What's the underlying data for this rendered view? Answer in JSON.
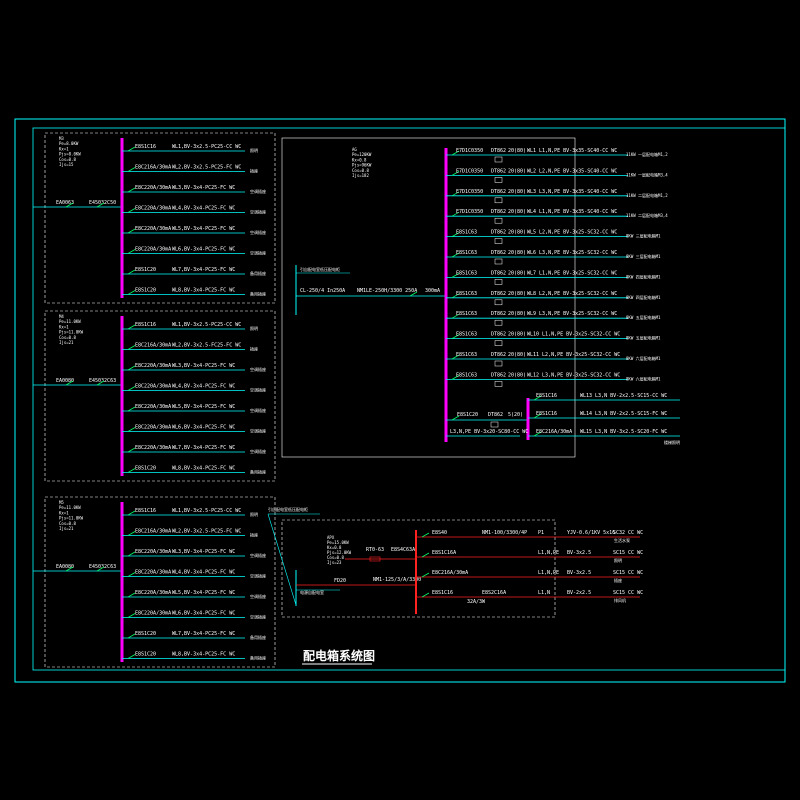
{
  "title": "配电箱系统图",
  "colors": {
    "border": "#00ffff",
    "panel_frame": "#ffffff",
    "busbar": "#ff00ff",
    "feeder": "#00ffff",
    "switch": "#00ff66",
    "red_bus": "#ff2020",
    "text": "#ffffff"
  },
  "panels": [
    {
      "id": "panel-1",
      "header": [
        "M3",
        "Pe=8.0KW",
        "Kx=1",
        "Pjs=8.0KW",
        "Cos=0.8",
        "Ijs=15"
      ],
      "incoming": [
        "EA0063",
        "E45032C50"
      ],
      "branches": [
        {
          "breaker": "E8S1C16",
          "cable": "WL1,BV-3x2.5-PC25-CC WC",
          "load": "照明"
        },
        {
          "breaker": "E8C216A/30mA",
          "cable": "WL2,BV-3x2.5-PC25-FC WC",
          "load": "插座"
        },
        {
          "breaker": "E8C220A/30mA",
          "cable": "WL3,BV-3x4-PC25-FC WC",
          "load": "空调插座"
        },
        {
          "breaker": "E8C220A/30mA",
          "cable": "WL4,BV-3x4-PC25-FC WC",
          "load": "空调插座"
        },
        {
          "breaker": "E8C220A/30mA",
          "cable": "WL5,BV-3x4-PC25-FC WC",
          "load": "空调插座"
        },
        {
          "breaker": "E8C220A/30mA",
          "cable": "WL6,BV-3x4-PC25-FC WC",
          "load": "空调插座"
        },
        {
          "breaker": "E8S1C20",
          "cable": "WL7,BV-3x4-PC25-FC WC",
          "load": "备用插座"
        },
        {
          "breaker": "E8S1C20",
          "cable": "WL8,BV-3x4-PC25-FC WC",
          "load": "备用插座"
        }
      ]
    },
    {
      "id": "panel-2",
      "header": [
        "M4",
        "Pe=11.0KW",
        "Kx=1",
        "Pjs=11.0KW",
        "Cos=0.8",
        "Ijs=21"
      ],
      "incoming": [
        "EA0080",
        "E45032C63"
      ],
      "branches": [
        {
          "breaker": "E8S1C16",
          "cable": "WL1,BV-3x2.5-PC25-CC WC",
          "load": "照明"
        },
        {
          "breaker": "E8C216A/30mA",
          "cable": "WL2,BV-3x2.5-FC25-FC WC",
          "load": "插座"
        },
        {
          "breaker": "E8C220A/30mA",
          "cable": "WL3,BV-3x4-PC25-FC WC",
          "load": "空调插座"
        },
        {
          "breaker": "E8C220A/30mA",
          "cable": "WL4,BV-3x4-PC25-FC WC",
          "load": "空调插座"
        },
        {
          "breaker": "E8C220A/30mA",
          "cable": "WL5,BV-3x4-PC25-FC WC",
          "load": "空调插座"
        },
        {
          "breaker": "E8C220A/30mA",
          "cable": "WL6,BV-3x4-PC25-FC WC",
          "load": "空调插座"
        },
        {
          "breaker": "E8C220A/30mA",
          "cable": "WL7,BV-3x4-PC25-FC WC",
          "load": "空调插座"
        },
        {
          "breaker": "E8S1C20",
          "cable": "WL8,BV-3x4-PC25-FC WC",
          "load": "备用插座"
        }
      ]
    },
    {
      "id": "panel-3",
      "header": [
        "M5",
        "Pe=11.0KW",
        "Kx=1",
        "Pjs=11.0KW",
        "Cos=0.8",
        "Ijs=21"
      ],
      "incoming": [
        "EA0080",
        "E45032C63"
      ],
      "branches": [
        {
          "breaker": "E8S1C16",
          "cable": "WL1,BV-3x2.5-PC25-CC WC",
          "load": "照明"
        },
        {
          "breaker": "E8C216A/30mA",
          "cable": "WL2,BV-3x2.5-PC25-FC WC",
          "load": "插座"
        },
        {
          "breaker": "E8C220A/30mA",
          "cable": "WL3,BV-3x4-PC25-FC WC",
          "load": "空调插座"
        },
        {
          "breaker": "E8C220A/30mA",
          "cable": "WL4,BV-3x4-PC25-FC WC",
          "load": "空调插座"
        },
        {
          "breaker": "E8C220A/30mA",
          "cable": "WL5,BV-3x4-PC25-FC WC",
          "load": "空调插座"
        },
        {
          "breaker": "E8C220A/30mA",
          "cable": "WL6,BV-3x4-PC25-FC WC",
          "load": "空调插座"
        },
        {
          "breaker": "E8S1C20",
          "cable": "WL7,BV-3x4-PC25-FC WC",
          "load": "备用插座"
        },
        {
          "breaker": "E8S1C20",
          "cable": "WL8,BV-3x4-PC25-FC WC",
          "load": "备用插座"
        }
      ]
    }
  ],
  "main_panel": {
    "header": [
      "AG",
      "Pe=120KW",
      "Kx=0.8",
      "Pjs=96KW",
      "Cos=0.8",
      "Ijs=182"
    ],
    "source": "引自配电室低压配电柜",
    "incoming_cable": "CL-250/4 In250A",
    "main_breaker": "NM1LE-250H/3300 250A",
    "main_rcd": "300mA",
    "spare_cable": "L3,N,PE BV-3x20-SC80-CC WC",
    "branches": [
      {
        "breaker": "E7D1C0350",
        "meter": "DT862",
        "ct": "20(80)",
        "cable": "WL1 L1,N,PE BV-3x35-SC40-CC WC",
        "load": "11KW 一层配电箱M1,2"
      },
      {
        "breaker": "E7D1C0350",
        "meter": "DT862",
        "ct": "20(80)",
        "cable": "WL2 L2,N,PE BV-3x35-SC40-CC WC",
        "load": "11KW 一层配电箱M3,4"
      },
      {
        "breaker": "E7D1C0350",
        "meter": "DT862",
        "ct": "20(80)",
        "cable": "WL3 L3,N,PE BV-3x35-SC40-CC WC",
        "load": "11KW 二层配电箱M1,2"
      },
      {
        "breaker": "E7D1C0350",
        "meter": "DT862",
        "ct": "20(80)",
        "cable": "WL4 L1,N,PE BV-3x35-SC40-CC WC",
        "load": "11KW 二层配电箱M3,4"
      },
      {
        "breaker": "E8S1C63",
        "meter": "DT862",
        "ct": "20(80)",
        "cable": "WL5 L2,N,PE BV-3x25-SC32-CC WC",
        "load": "8KW 三层配电箱M1"
      },
      {
        "breaker": "E8S1C63",
        "meter": "DT862",
        "ct": "20(80)",
        "cable": "WL6 L3,N,PE BV-3x25-SC32-CC WC",
        "load": "8KW 三层配电箱M1"
      },
      {
        "breaker": "E8S1C63",
        "meter": "DT862",
        "ct": "20(80)",
        "cable": "WL7 L1,N,PE BV-3x25-SC32-CC WC",
        "load": "8KW 四层配电箱M1"
      },
      {
        "breaker": "E8S1C63",
        "meter": "DT862",
        "ct": "20(80)",
        "cable": "WL8 L2,N,PE BV-3x25-SC32-CC WC",
        "load": "8KW 四层配电箱M1"
      },
      {
        "breaker": "E8S1C63",
        "meter": "DT862",
        "ct": "20(80)",
        "cable": "WL9 L3,N,PE BV-3x25-SC32-CC WC",
        "load": "8KW 五层配电箱M1"
      },
      {
        "breaker": "E8S1C63",
        "meter": "DT862",
        "ct": "20(80)",
        "cable": "WL10 L1,N,PE BV-3x25-SC32-CC WC",
        "load": "8KW 五层配电箱M1"
      },
      {
        "breaker": "E8S1C63",
        "meter": "DT862",
        "ct": "20(80)",
        "cable": "WL11 L2,N,PE BV-3x25-SC32-CC WC",
        "load": "8KW 六层配电箱M1"
      },
      {
        "breaker": "E8S1C63",
        "meter": "DT862",
        "ct": "20(80)",
        "cable": "WL12 L3,N,PE BV-3x25-SC32-CC WC",
        "load": "8KW 六层配电箱M1"
      }
    ],
    "sub_feed": {
      "breaker": "E8S1C20",
      "meter": "DT862",
      "ct": "5(20)",
      "branches": [
        {
          "breaker": "E8S1C16",
          "cable": "WL13 L3,N BV-2x2.5-SC15-CC WC"
        },
        {
          "breaker": "E8S1C16",
          "cable": "WL14 L3,N BV-2x2.5-SC15-FC WC"
        },
        {
          "breaker": "E8C216A/30mA",
          "cable": "WL15 L3,N BV-3x2.5-SC20-FC WC"
        }
      ],
      "load": "楼梯照明"
    }
  },
  "pump_panel": {
    "header": [
      "APX",
      "Pe=15.0KW",
      "Kx=0.8",
      "Pjs=12.0KW",
      "Cos=0.8",
      "Ijs=23"
    ],
    "source": "引自配电室低压配电柜",
    "source_cable": "电源自配电室",
    "fuse": "RT0-63",
    "rcd": "E8S4C63A",
    "main_label": "FD20",
    "main_breaker": "NM1-125/3/A/3300",
    "branches": [
      {
        "breaker": "E8S40",
        "device": "NM1-100/3300/4P",
        "phase": "P1",
        "cable": "YJV-0.6/1KV 5x16",
        "conduit": "SC32 CC WC",
        "load": "生活水泵"
      },
      {
        "breaker": "E8S1C16A",
        "device": "",
        "phase": "L1,N,PE",
        "cable": "BV-3x2.5",
        "conduit": "SC15 CC WC",
        "load": "照明"
      },
      {
        "breaker": "E8C216A/30mA",
        "device": "",
        "phase": "L1,N,PE",
        "cable": "BV-3x2.5",
        "conduit": "SC15 CC WC",
        "load": "插座"
      },
      {
        "breaker": "E8S1C16",
        "device": "E8S2C16A",
        "phase": "L1,N",
        "cable": "BV-2x2.5",
        "conduit": "SC15 CC WC",
        "load": "排风机",
        "extra": "32A/3W"
      }
    ]
  }
}
